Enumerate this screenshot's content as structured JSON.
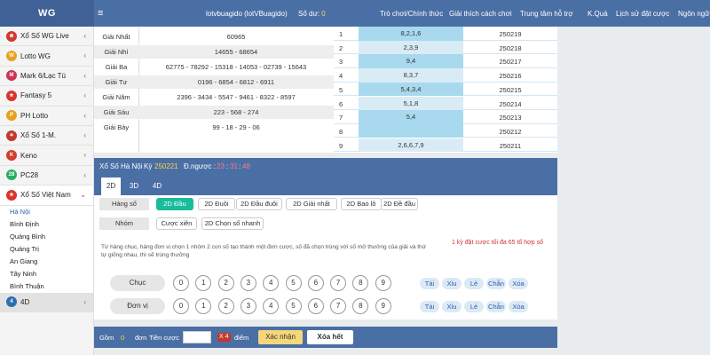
{
  "header": {
    "logo": "WG",
    "menu_icon": "≡",
    "user": "lotvbuagido (lotVBuagido)",
    "balance_label": "Số dư:",
    "balance_value": "0",
    "nav": [
      "Trò chơi/Chính thức",
      "Giải thích cách chơi",
      "Trung tâm hỗ trợ",
      "K.Quả",
      "Lịch sử đặt cược",
      "Ngôn ngữ"
    ]
  },
  "sidebar": {
    "items": [
      {
        "label": "Xổ Số WG Live",
        "icon_color": "#d03a2f",
        "icon": "⊗"
      },
      {
        "label": "Lotto WG",
        "icon_color": "#e8a21b",
        "icon": "W"
      },
      {
        "label": "Mark 6/Lạc Tú",
        "icon_color": "#cc3355",
        "icon": "M"
      },
      {
        "label": "Fantasy 5",
        "icon_color": "#d9342b",
        "icon": "★"
      },
      {
        "label": "PH Lotto",
        "icon_color": "#e89f1c",
        "icon": "P"
      },
      {
        "label": "Xổ Số 1-M.",
        "icon_color": "#c0392b",
        "icon": "✶"
      },
      {
        "label": "Keno",
        "icon_color": "#d33b2c",
        "icon": "K"
      },
      {
        "label": "PC28",
        "icon_color": "#27ae60",
        "icon": "28"
      },
      {
        "label": "Xổ Số Việt Nam",
        "icon_color": "#d9342b",
        "icon": "★"
      }
    ],
    "sub_items": [
      "Hà Nội",
      "Bình Định",
      "Quảng Bình",
      "Quảng Trị",
      "An Giang",
      "Tây Ninh",
      "Bình Thuận"
    ],
    "last_item": {
      "label": "4D",
      "icon_color": "#2a6fb0",
      "icon": "4"
    }
  },
  "results": {
    "prizes": [
      {
        "label": "Giải Nhất",
        "value": "60965"
      },
      {
        "label": "Giải Nhì",
        "value": "14655 - 68654"
      },
      {
        "label": "Giải Ba",
        "value": "62775 - 78292 - 15318 - 14053 - 02739 - 15643"
      },
      {
        "label": "Giải Tư",
        "value": "0196 - 6854 - 6812 - 6911"
      },
      {
        "label": "Giải Năm",
        "value": "2396 - 3434 - 5547 - 9461 - 8322 - 8597"
      },
      {
        "label": "Giải Sáu",
        "value": "223 - 568 - 274"
      },
      {
        "label": "Giải Bảy",
        "value": "99 - 18 - 29 - 06"
      }
    ],
    "stats": [
      {
        "idx": "1",
        "nums": "8,2,1,6",
        "period": "250219"
      },
      {
        "idx": "2",
        "nums": "2,3,9",
        "period": "250218"
      },
      {
        "idx": "3",
        "nums": "9,4",
        "period": "250217"
      },
      {
        "idx": "4",
        "nums": "8,3,7",
        "period": "250216"
      },
      {
        "idx": "5",
        "nums": "5,4,3,4",
        "period": "250215"
      },
      {
        "idx": "6",
        "nums": "5,1,8",
        "period": "250214"
      },
      {
        "idx": "7",
        "nums": "5,4",
        "period": "250213"
      },
      {
        "idx": "8",
        "nums": "",
        "period": "250212"
      },
      {
        "idx": "9",
        "nums": "2,6,6,7,9",
        "period": "250211"
      }
    ]
  },
  "game": {
    "title": "Xổ Số Hà Nội",
    "period_label": "Kỳ",
    "period": "250221",
    "countdown_label": "Đ.ngược :",
    "countdown_h": "23",
    "countdown_m": "31",
    "countdown_s": "48",
    "tabs": [
      "2D",
      "3D",
      "4D"
    ],
    "row1_label": "Hàng số",
    "row1_options": [
      "2D Đầu",
      "2D Đuôi",
      "2D Đầu đuôi",
      "2D Giải nhất",
      "2D Bao lô",
      "2D Đề đầu"
    ],
    "row2_label": "Nhóm",
    "row2_options": [
      "Cược xiên",
      "2D Chọn số nhanh"
    ],
    "note": "Từ hàng chục, hàng đơn vị chọn 1 nhóm 2 con số tạo thành một đơn cược, số đã chọn trùng với số mở thưởng của giải và thứ tự giống nhau, thì sẽ trúng thưởng",
    "limit": "1 kỳ đặt cược tối đa 65 tổ hợp số",
    "rows": [
      "Chục",
      "Đơn vị"
    ],
    "digits": [
      "0",
      "1",
      "2",
      "3",
      "4",
      "5",
      "6",
      "7",
      "8",
      "9"
    ],
    "quick": [
      "Tài",
      "Xỉu",
      "Lẻ",
      "Chẵn",
      "Xóa"
    ]
  },
  "bottom": {
    "total_label": "Gồm",
    "total_value": "0",
    "unit_label": "đơn",
    "amount_label": "Tiền cược",
    "multiplier": "X 4",
    "points_label": "điểm",
    "confirm": "Xác nhận",
    "clear": "Xóa hết"
  }
}
